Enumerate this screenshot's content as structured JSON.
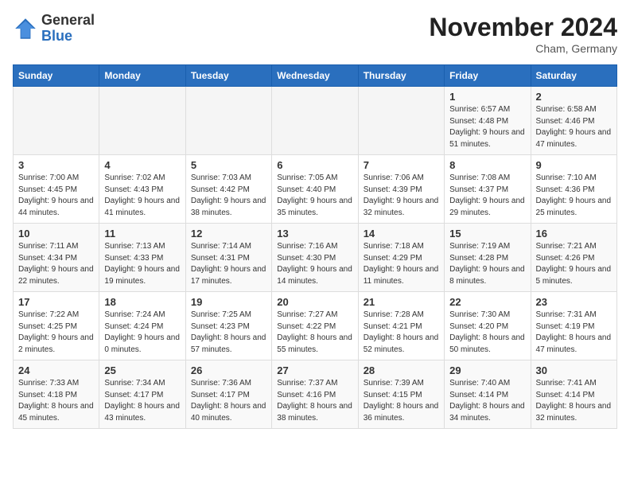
{
  "header": {
    "logo_general": "General",
    "logo_blue": "Blue",
    "month_title": "November 2024",
    "location": "Cham, Germany"
  },
  "weekdays": [
    "Sunday",
    "Monday",
    "Tuesday",
    "Wednesday",
    "Thursday",
    "Friday",
    "Saturday"
  ],
  "weeks": [
    [
      {
        "day": "",
        "info": ""
      },
      {
        "day": "",
        "info": ""
      },
      {
        "day": "",
        "info": ""
      },
      {
        "day": "",
        "info": ""
      },
      {
        "day": "",
        "info": ""
      },
      {
        "day": "1",
        "info": "Sunrise: 6:57 AM\nSunset: 4:48 PM\nDaylight: 9 hours and 51 minutes."
      },
      {
        "day": "2",
        "info": "Sunrise: 6:58 AM\nSunset: 4:46 PM\nDaylight: 9 hours and 47 minutes."
      }
    ],
    [
      {
        "day": "3",
        "info": "Sunrise: 7:00 AM\nSunset: 4:45 PM\nDaylight: 9 hours and 44 minutes."
      },
      {
        "day": "4",
        "info": "Sunrise: 7:02 AM\nSunset: 4:43 PM\nDaylight: 9 hours and 41 minutes."
      },
      {
        "day": "5",
        "info": "Sunrise: 7:03 AM\nSunset: 4:42 PM\nDaylight: 9 hours and 38 minutes."
      },
      {
        "day": "6",
        "info": "Sunrise: 7:05 AM\nSunset: 4:40 PM\nDaylight: 9 hours and 35 minutes."
      },
      {
        "day": "7",
        "info": "Sunrise: 7:06 AM\nSunset: 4:39 PM\nDaylight: 9 hours and 32 minutes."
      },
      {
        "day": "8",
        "info": "Sunrise: 7:08 AM\nSunset: 4:37 PM\nDaylight: 9 hours and 29 minutes."
      },
      {
        "day": "9",
        "info": "Sunrise: 7:10 AM\nSunset: 4:36 PM\nDaylight: 9 hours and 25 minutes."
      }
    ],
    [
      {
        "day": "10",
        "info": "Sunrise: 7:11 AM\nSunset: 4:34 PM\nDaylight: 9 hours and 22 minutes."
      },
      {
        "day": "11",
        "info": "Sunrise: 7:13 AM\nSunset: 4:33 PM\nDaylight: 9 hours and 19 minutes."
      },
      {
        "day": "12",
        "info": "Sunrise: 7:14 AM\nSunset: 4:31 PM\nDaylight: 9 hours and 17 minutes."
      },
      {
        "day": "13",
        "info": "Sunrise: 7:16 AM\nSunset: 4:30 PM\nDaylight: 9 hours and 14 minutes."
      },
      {
        "day": "14",
        "info": "Sunrise: 7:18 AM\nSunset: 4:29 PM\nDaylight: 9 hours and 11 minutes."
      },
      {
        "day": "15",
        "info": "Sunrise: 7:19 AM\nSunset: 4:28 PM\nDaylight: 9 hours and 8 minutes."
      },
      {
        "day": "16",
        "info": "Sunrise: 7:21 AM\nSunset: 4:26 PM\nDaylight: 9 hours and 5 minutes."
      }
    ],
    [
      {
        "day": "17",
        "info": "Sunrise: 7:22 AM\nSunset: 4:25 PM\nDaylight: 9 hours and 2 minutes."
      },
      {
        "day": "18",
        "info": "Sunrise: 7:24 AM\nSunset: 4:24 PM\nDaylight: 9 hours and 0 minutes."
      },
      {
        "day": "19",
        "info": "Sunrise: 7:25 AM\nSunset: 4:23 PM\nDaylight: 8 hours and 57 minutes."
      },
      {
        "day": "20",
        "info": "Sunrise: 7:27 AM\nSunset: 4:22 PM\nDaylight: 8 hours and 55 minutes."
      },
      {
        "day": "21",
        "info": "Sunrise: 7:28 AM\nSunset: 4:21 PM\nDaylight: 8 hours and 52 minutes."
      },
      {
        "day": "22",
        "info": "Sunrise: 7:30 AM\nSunset: 4:20 PM\nDaylight: 8 hours and 50 minutes."
      },
      {
        "day": "23",
        "info": "Sunrise: 7:31 AM\nSunset: 4:19 PM\nDaylight: 8 hours and 47 minutes."
      }
    ],
    [
      {
        "day": "24",
        "info": "Sunrise: 7:33 AM\nSunset: 4:18 PM\nDaylight: 8 hours and 45 minutes."
      },
      {
        "day": "25",
        "info": "Sunrise: 7:34 AM\nSunset: 4:17 PM\nDaylight: 8 hours and 43 minutes."
      },
      {
        "day": "26",
        "info": "Sunrise: 7:36 AM\nSunset: 4:17 PM\nDaylight: 8 hours and 40 minutes."
      },
      {
        "day": "27",
        "info": "Sunrise: 7:37 AM\nSunset: 4:16 PM\nDaylight: 8 hours and 38 minutes."
      },
      {
        "day": "28",
        "info": "Sunrise: 7:39 AM\nSunset: 4:15 PM\nDaylight: 8 hours and 36 minutes."
      },
      {
        "day": "29",
        "info": "Sunrise: 7:40 AM\nSunset: 4:14 PM\nDaylight: 8 hours and 34 minutes."
      },
      {
        "day": "30",
        "info": "Sunrise: 7:41 AM\nSunset: 4:14 PM\nDaylight: 8 hours and 32 minutes."
      }
    ]
  ]
}
